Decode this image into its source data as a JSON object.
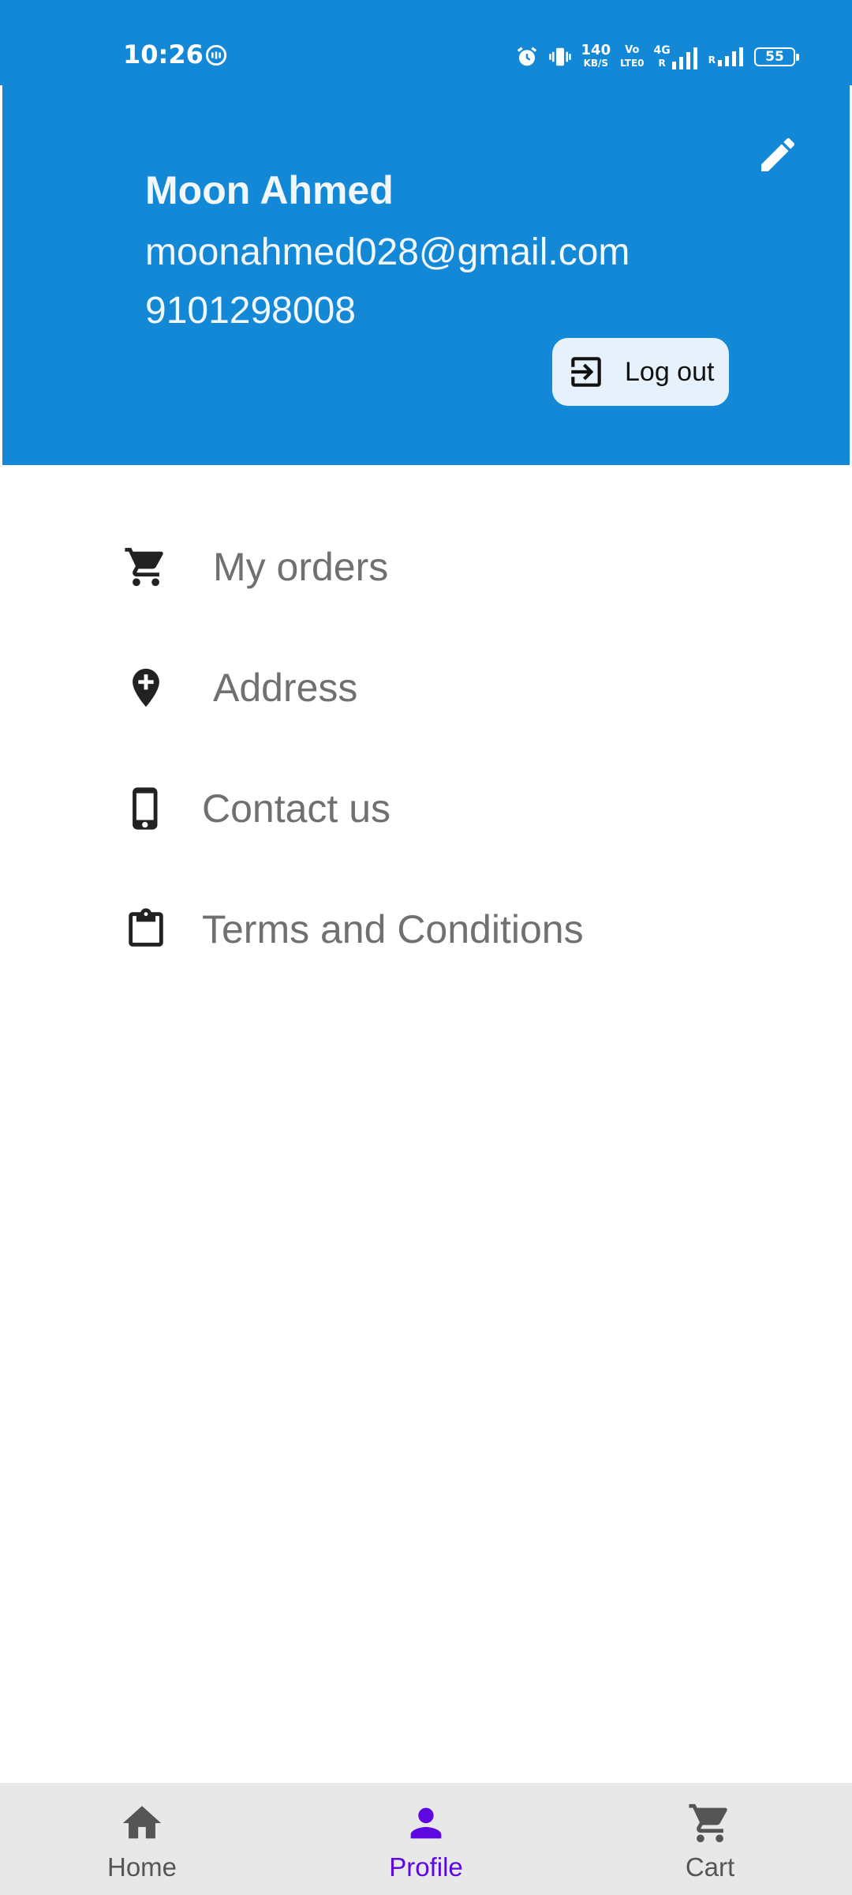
{
  "status_bar": {
    "time": "10:26",
    "network_speed_value": "140",
    "network_speed_unit": "KB/S",
    "volte_top": "Vo",
    "volte_bottom": "LTE0",
    "network_type": "4G",
    "roaming": "R",
    "battery": "55"
  },
  "profile": {
    "name": "Moon Ahmed",
    "email": "moonahmed028@gmail.com",
    "phone": "9101298008",
    "logout_label": "Log out"
  },
  "menu": {
    "items": [
      {
        "label": "My orders",
        "icon": "cart-icon"
      },
      {
        "label": "Address",
        "icon": "add-location-icon"
      },
      {
        "label": "Contact us",
        "icon": "phone-icon"
      },
      {
        "label": "Terms and Conditions",
        "icon": "clipboard-icon"
      }
    ]
  },
  "bottom_nav": {
    "items": [
      {
        "label": "Home",
        "icon": "home-icon",
        "active": false
      },
      {
        "label": "Profile",
        "icon": "person-icon",
        "active": true
      },
      {
        "label": "Cart",
        "icon": "cart-icon",
        "active": false
      }
    ]
  },
  "colors": {
    "header_blue": "#1388d6",
    "active_nav": "#5d08e0",
    "menu_text": "#707070",
    "bottom_nav_bg": "#e8e8e8"
  }
}
